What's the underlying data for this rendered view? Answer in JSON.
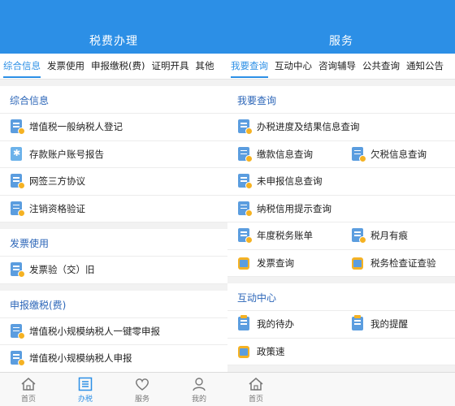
{
  "left": {
    "title": "税费办理",
    "tabs": [
      "综合信息",
      "发票使用",
      "申报缴税(费)",
      "证明开具",
      "其他"
    ],
    "sections": [
      {
        "title": "综合信息",
        "items": [
          "增值税一般纳税人登记",
          "存款账户账号报告",
          "网签三方协议",
          "注销资格验证"
        ]
      },
      {
        "title": "发票使用",
        "items": [
          "发票验（交）旧"
        ]
      },
      {
        "title": "申报缴税(费)",
        "items": [
          "增值税小规模纳税人一键零申报",
          "增值税小规模纳税人申报"
        ]
      }
    ],
    "nav": [
      "首页",
      "办税",
      "服务",
      "我的"
    ]
  },
  "right": {
    "title": "服务",
    "tabs": [
      "我要查询",
      "互动中心",
      "咨询辅导",
      "公共查询",
      "通知公告"
    ],
    "sections": [
      {
        "title": "我要查询",
        "items": [
          "办税进度及结果信息查询",
          "缴款信息查询",
          "欠税信息查询",
          "未申报信息查询",
          "纳税信用提示查询",
          "年度税务账单",
          "税月有痕",
          "发票查询",
          "税务检查证查验"
        ]
      },
      {
        "title": "互动中心",
        "items": [
          "我的待办",
          "我的提醒",
          "政策速"
        ]
      }
    ],
    "nav": [
      "首页"
    ]
  },
  "colors": {
    "primary": "#2c8fe6",
    "section_title": "#2c66b8",
    "badge": "#f5b223"
  }
}
